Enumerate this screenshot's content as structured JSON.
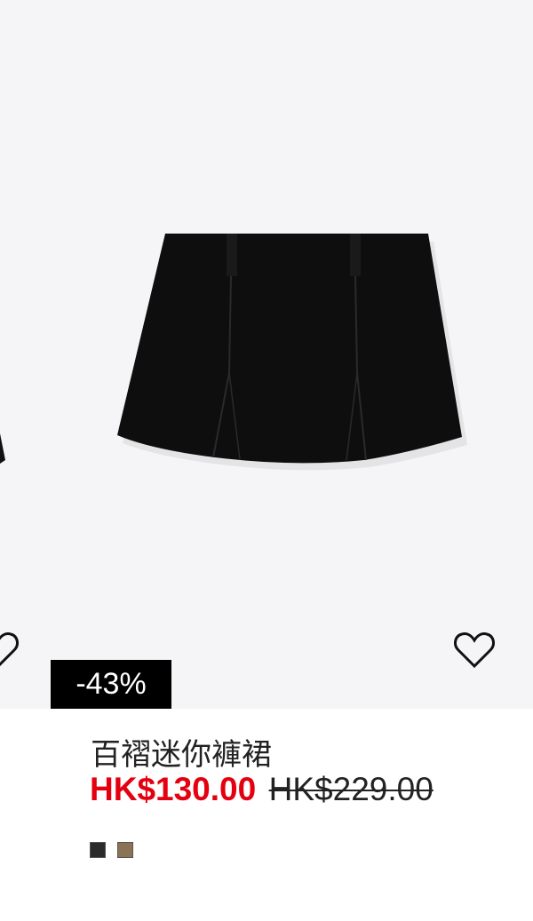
{
  "product": {
    "discount_badge": "-43%",
    "title": "百褶迷你褲裙",
    "sale_price": "HK$130.00",
    "original_price": "HK$229.00",
    "swatches": [
      {
        "name": "black",
        "color": "#2b2b2b"
      },
      {
        "name": "brown",
        "color": "#8b7355"
      }
    ],
    "favorite_icon": "heart-outline-icon"
  },
  "colors": {
    "image_background": "#f5f5f7",
    "sale_red": "#e50010",
    "badge_background": "#000000"
  }
}
